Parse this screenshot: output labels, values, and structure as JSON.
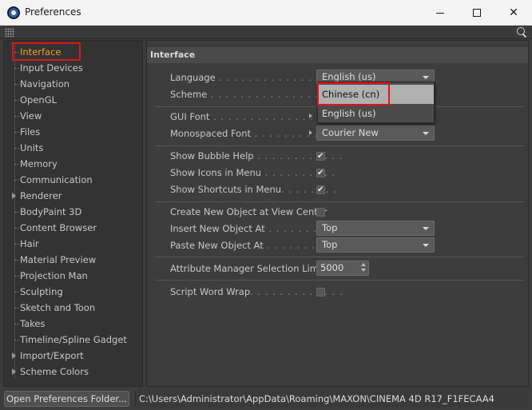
{
  "window": {
    "title": "Preferences",
    "icon": "cinema4d-logo-icon"
  },
  "sidebar": {
    "items": [
      {
        "label": "Interface",
        "selected": true,
        "expandable": false
      },
      {
        "label": "Input Devices",
        "expandable": false
      },
      {
        "label": "Navigation",
        "expandable": false
      },
      {
        "label": "OpenGL",
        "expandable": false
      },
      {
        "label": "View",
        "expandable": false
      },
      {
        "label": "Files",
        "expandable": false
      },
      {
        "label": "Units",
        "expandable": false
      },
      {
        "label": "Memory",
        "expandable": false
      },
      {
        "label": "Communication",
        "expandable": false
      },
      {
        "label": "Renderer",
        "expandable": true
      },
      {
        "label": "BodyPaint 3D",
        "expandable": false
      },
      {
        "label": "Content Browser",
        "expandable": false
      },
      {
        "label": "Hair",
        "expandable": false
      },
      {
        "label": "Material Preview",
        "expandable": false
      },
      {
        "label": "Projection Man",
        "expandable": false
      },
      {
        "label": "Sculpting",
        "expandable": false
      },
      {
        "label": "Sketch and Toon",
        "expandable": false
      },
      {
        "label": "Takes",
        "expandable": false
      },
      {
        "label": "Timeline/Spline Gadget",
        "expandable": false
      },
      {
        "label": "Import/Export",
        "expandable": true
      },
      {
        "label": "Scheme Colors",
        "expandable": true
      }
    ]
  },
  "panel": {
    "header": "Interface",
    "language": {
      "label": "Language",
      "dots": " . . . . . . . . . . . . . . . . . . .",
      "value": "English (us)"
    },
    "scheme": {
      "label": "Scheme",
      "dots": " . . . . . . . . . . . . . . . . . . . ."
    },
    "gui_font": {
      "label": "GUI Font",
      "dots": " . . . . . . . . . . . . . . . . . . ."
    },
    "mono_font": {
      "label": "Monospaced Font",
      "dots": " . . . . . . . . . . .",
      "value": "Courier New"
    },
    "bubble_help": {
      "label": "Show Bubble Help",
      "dots": " . . . . . . . . . . . .",
      "checked": true
    },
    "icons_in_menu": {
      "label": "Show Icons in Menu",
      "dots": " . . . . . . . . . .",
      "checked": true
    },
    "shortcuts_in_menu": {
      "label": "Show Shortcuts in Menu",
      "dots": ". . . . . . . .",
      "checked": true
    },
    "create_at_center": {
      "label": "Create New Object at View Center",
      "checked": false
    },
    "insert_at": {
      "label": "Insert New Object At",
      "dots": " . . . . . . . . . . .",
      "value": "Top"
    },
    "paste_at": {
      "label": "Paste New Object At",
      "dots": " . . . . . . . . . . .",
      "value": "Top"
    },
    "selection_limit": {
      "label": "Attribute Manager Selection Limit",
      "value": "5000"
    },
    "word_wrap": {
      "label": "Script Word Wrap",
      "dots": ". . . . . . . . . . . . .",
      "checked": false
    }
  },
  "language_popup": {
    "options": [
      "Chinese (cn)",
      "English (us)"
    ],
    "hovered": "Chinese (cn)"
  },
  "footer": {
    "button_label": "Open Preferences Folder...",
    "path": "C:\\Users\\Administrator\\AppData\\Roaming\\MAXON\\CINEMA 4D R17_F1FECAA4"
  },
  "colors": {
    "selected_item": "#f0a020",
    "highlight_box": "#e0141e"
  }
}
